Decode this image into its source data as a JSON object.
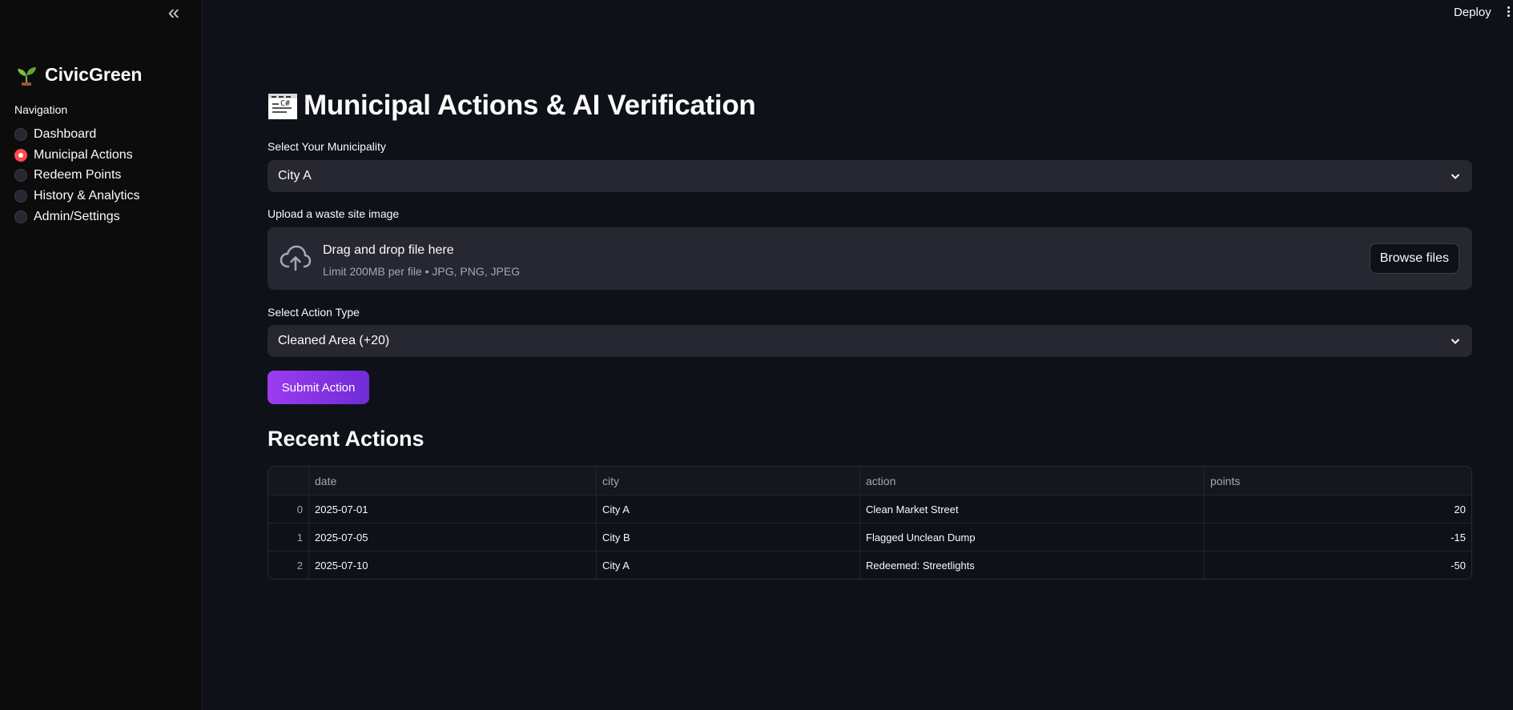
{
  "app": {
    "name": "CivicGreen",
    "deploy_label": "Deploy"
  },
  "sidebar": {
    "nav_label": "Navigation",
    "selected": "Municipal Actions",
    "items": [
      {
        "label": "Dashboard",
        "checked": false
      },
      {
        "label": "Municipal Actions",
        "checked": true
      },
      {
        "label": "Redeem Points",
        "checked": false
      },
      {
        "label": "History & Analytics",
        "checked": false
      },
      {
        "label": "Admin/Settings",
        "checked": false
      }
    ]
  },
  "main": {
    "title": "Municipal Actions & AI Verification",
    "municipality": {
      "label": "Select Your Municipality",
      "value": "City A"
    },
    "upload": {
      "label": "Upload a waste site image",
      "drop_title": "Drag and drop file here",
      "drop_sub": "Limit 200MB per file • JPG, PNG, JPEG",
      "browse_label": "Browse files"
    },
    "action_type": {
      "label": "Select Action Type",
      "value": "Cleaned Area (+20)"
    },
    "submit_label": "Submit Action",
    "recent": {
      "title": "Recent Actions",
      "columns": [
        "",
        "date",
        "city",
        "action",
        "points"
      ],
      "rows": [
        {
          "index": "0",
          "date": "2025-07-01",
          "city": "City A",
          "action": "Clean Market Street",
          "points": "20"
        },
        {
          "index": "1",
          "date": "2025-07-05",
          "city": "City B",
          "action": "Flagged Unclean Dump",
          "points": "-15"
        },
        {
          "index": "2",
          "date": "2025-07-10",
          "city": "City A",
          "action": "Redeemed: Streetlights",
          "points": "-50"
        }
      ]
    }
  },
  "colors": {
    "background": "#0e1117",
    "sidebar": "#0c0c0c",
    "input": "#262730",
    "radio_active": "#ff4b4b",
    "button_gradient_start": "#9b3cf0",
    "button_gradient_end": "#6f2bd6"
  },
  "icons": {
    "collapse": "double-chevron-left-icon",
    "brand": "seedling-icon",
    "title": "construction-sign-icon",
    "upload": "cloud-upload-icon",
    "select": "chevron-down-icon",
    "menu": "vertical-dots-icon"
  }
}
